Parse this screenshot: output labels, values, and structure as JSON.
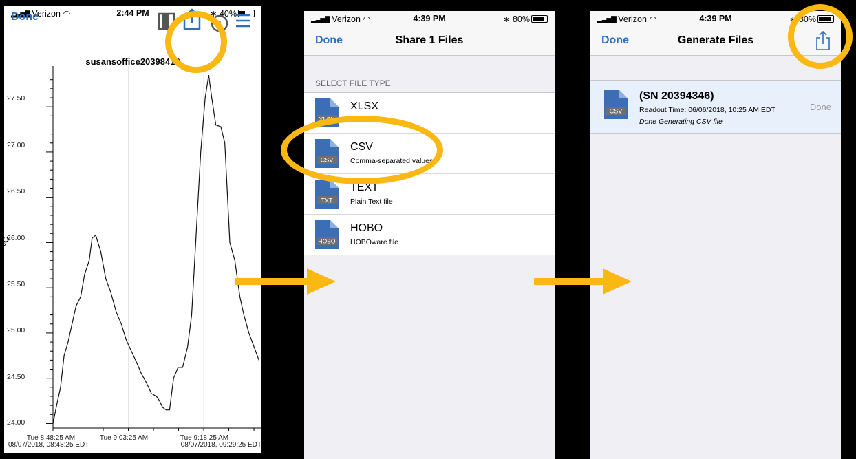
{
  "panel1": {
    "status": {
      "carrier": "Verizon",
      "time": "2:44 PM",
      "battery": "40%"
    },
    "nav": {
      "done": "Done"
    },
    "chart_title": "susansoffice20398418",
    "y_unit": "°C",
    "y_ticks": [
      "27.50",
      "27.00",
      "26.50",
      "26.00",
      "25.50",
      "25.00",
      "24.50",
      "24.00"
    ],
    "x_ticks": [
      "Tue 8:48:25 AM",
      "Tue 9:03:25 AM",
      "Tue 9:18:25 AM"
    ],
    "x_start": "08/07/2018, 08:48:25 EDT",
    "x_end": "08/07/2018, 09:29:25 EDT"
  },
  "chart_data": {
    "type": "line",
    "title": "susansoffice20398418",
    "ylabel": "°C",
    "xlabel": "",
    "ylim": [
      23.95,
      27.95
    ],
    "x_unit": "minutes",
    "x": [
      0,
      0.8,
      1.5,
      2.2,
      3,
      3.8,
      4.6,
      5.5,
      6.3,
      7.2,
      7.8,
      8.5,
      9.5,
      10.5,
      11.5,
      12.6,
      13.6,
      14.6,
      15.6,
      16.6,
      17.6,
      18.6,
      19.6,
      20.6,
      21.2,
      21.8,
      22.5,
      23.2,
      24,
      24.9,
      25.8,
      26.8,
      27.6,
      28.4,
      29.4,
      30.3,
      31,
      31.6,
      32.4,
      33.4,
      34.2,
      35.2,
      36.2,
      37.2,
      38,
      39,
      40,
      41
    ],
    "y": [
      24.0,
      24.22,
      24.4,
      24.75,
      24.9,
      25.1,
      25.3,
      25.4,
      25.65,
      25.8,
      26.05,
      26.08,
      25.9,
      25.6,
      25.45,
      25.23,
      25.1,
      24.92,
      24.8,
      24.68,
      24.55,
      24.45,
      24.33,
      24.3,
      24.25,
      24.18,
      24.15,
      24.15,
      24.5,
      24.62,
      24.62,
      24.85,
      25.2,
      26.0,
      27.0,
      27.6,
      27.85,
      27.6,
      27.3,
      27.28,
      27.1,
      26.0,
      25.8,
      25.4,
      25.2,
      25.0,
      24.85,
      24.7
    ]
  },
  "panel2": {
    "status": {
      "carrier": "Verizon",
      "time": "4:39 PM",
      "battery": "80%"
    },
    "nav": {
      "done": "Done",
      "title": "Share 1 Files"
    },
    "section": "SELECT FILE TYPE",
    "items": [
      {
        "badge": "XLSX",
        "name": "XLSX",
        "desc": ""
      },
      {
        "badge": "CSV",
        "name": "CSV",
        "desc": "Comma-separated values"
      },
      {
        "badge": "TXT",
        "name": "TEXT",
        "desc": "Plain Text file"
      },
      {
        "badge": "HOBO",
        "name": "HOBO",
        "desc": "HOBOware file"
      }
    ]
  },
  "panel3": {
    "status": {
      "carrier": "Verizon",
      "time": "4:39 PM",
      "battery": "80%"
    },
    "nav": {
      "done": "Done",
      "title": "Generate Files"
    },
    "file": {
      "badge": "CSV",
      "serial": "(SN 20394346)",
      "readout": "Readout Time: 06/06/2018, 10:25 AM EDT",
      "status": "Done Generating CSV file",
      "done": "Done"
    }
  },
  "colors": {
    "accent": "#2e6fbe",
    "highlight": "#fbb813",
    "file_icon": "#3b6eb5"
  }
}
